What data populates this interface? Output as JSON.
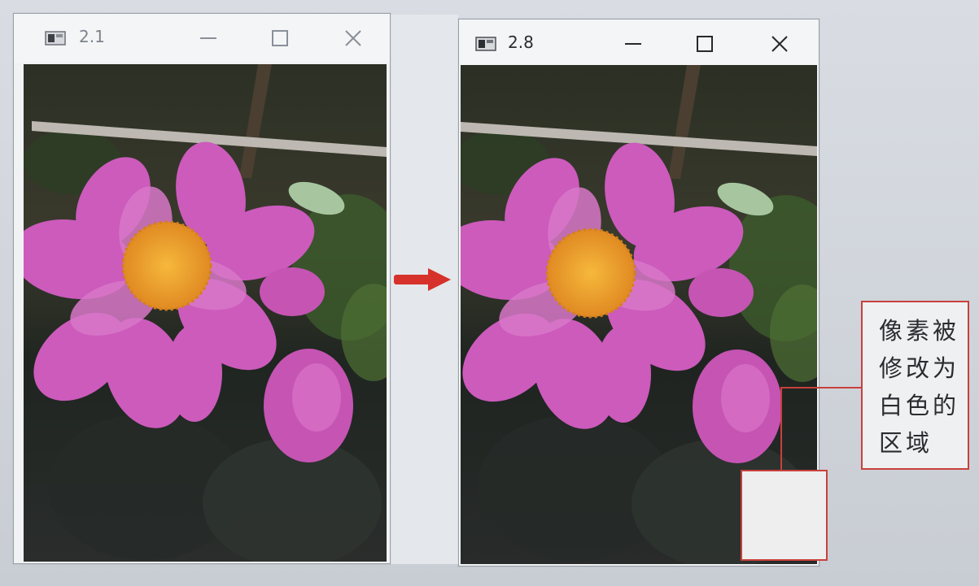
{
  "windows": [
    {
      "title": "2.1"
    },
    {
      "title": "2.8"
    }
  ],
  "titlebar_buttons": {
    "minimize": "minimize-icon",
    "maximize": "maximize-icon",
    "close": "close-icon"
  },
  "annotation": {
    "lines": [
      "像素被",
      "修改为",
      "白色的",
      "区域"
    ]
  },
  "colors": {
    "accent_red": "#c9403c",
    "arrow_red": "#d6312b",
    "petal_pink": "#cd5bbd",
    "center_yellow": "#f0a52e",
    "white_region": "#eeeeef"
  }
}
